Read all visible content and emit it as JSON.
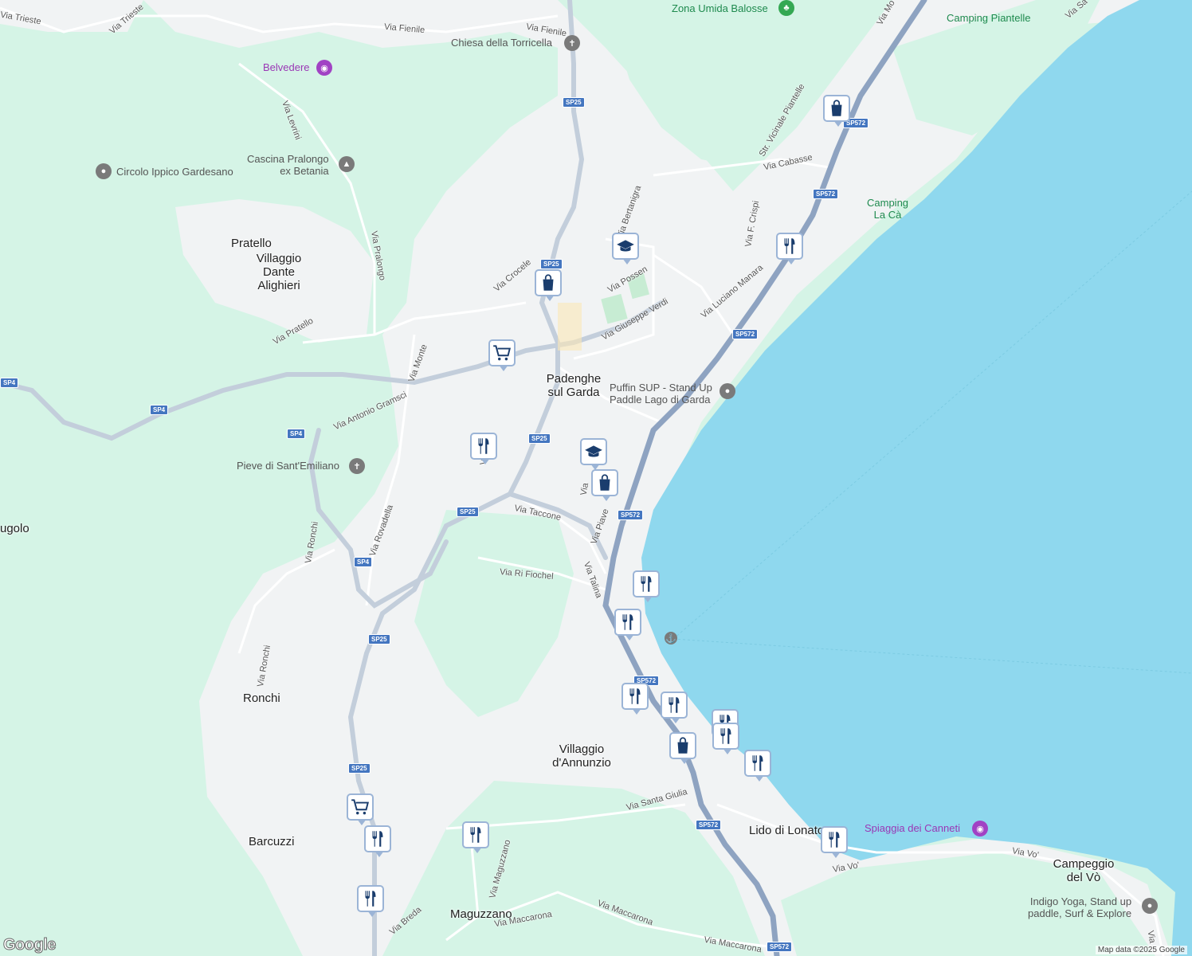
{
  "map": {
    "credit": "Map data ©2025 Google",
    "logo": "Google"
  },
  "colors": {
    "land_green": "#d5f4e6",
    "urban": "#f1f3f4",
    "lake": "#8fd8ee",
    "road": "#ffffff",
    "highway": "#8ea3c1",
    "marker_icon": "#1a3d6d"
  },
  "places": {
    "padenghe": "Padenghe\nsul Garda",
    "pratello": "Pratello",
    "villaggio_dante": "Villaggio\nDante\nAlighieri",
    "ronchi": "Ronchi",
    "barcuzzi": "Barcuzzi",
    "villaggio_annunzio": "Villaggio\nd'Annunzio",
    "maguzzano": "Maguzzano",
    "lido_lonato": "Lido di Lonato",
    "campeggio_vo": "Campeggio\ndel Vò",
    "ugolo": "ugolo"
  },
  "pois": {
    "zona_umida": "Zona Umida Balosse",
    "camping_piantelle": "Camping Piantelle",
    "chiesa": "Chiesa della Torricella",
    "belvedere": "Belvedere",
    "cascina": "Cascina Pralongo\nex Betania",
    "circolo": "Circolo Ippico Gardesano",
    "camping_la_ca": "Camping\nLa Cà",
    "puffin": "Puffin SUP - Stand Up\nPaddle Lago di Garda",
    "pieve": "Pieve di Sant'Emiliano",
    "spiaggia": "Spiaggia dei Canneti",
    "indigo": "Indigo Yoga, Stand up\npaddle, Surf & Explore"
  },
  "streets": {
    "via_trieste": "Via Trieste",
    "via_fienile": "Via Fienile",
    "via_levrini": "Via Levrini",
    "via_pralongo": "Via Pralongo",
    "via_pratello": "Via Pratello",
    "via_monte": "Via Monte",
    "via_gramsci": "Via Antonio Gramsci",
    "via_croce": "Via Crocele",
    "via_bertanigra": "Via Bertanigra",
    "via_possen": "Via Possen",
    "via_verdi": "Via Giuseppe Verdi",
    "via_cabasse": "Via Cabasse",
    "str_piantelle": "Str. Vicinale Piantelle",
    "via_crispi": "Via F. Crispi",
    "via_manara": "Via Luciano Manara",
    "via_taccone": "Via Taccone",
    "via_piave": "Via Piave",
    "via_talina": "Via Talina",
    "via_fiochel": "Via Ri Fiochel",
    "via_rovadella": "Via Rovadella",
    "via_ronchi": "Via Ronchi",
    "via_ronchi2": "Via Ronchi",
    "via_santa_giulia": "Via Santa Giulia",
    "via_maguzzano": "Via Maguzzano",
    "via_maccarona": "Via Maccarona",
    "via_maccarona2": "Via Maccarona",
    "via_maccarona3": "Via Maccarona",
    "via_breda": "Via Breda",
    "via_vo": "Via Vo'",
    "via_vo2": "Via Vo'",
    "via_mo": "Via Mo",
    "via_sa": "Via Sa",
    "via_p": "Via P",
    "via_via": "Via"
  },
  "shields": {
    "sp25_a": "SP25",
    "sp25_b": "SP25",
    "sp25_c": "SP25",
    "sp25_d": "SP25",
    "sp25_e": "SP25",
    "sp25_f": "SP25",
    "sp4_a": "SP4",
    "sp4_b": "SP4",
    "sp4_c": "SP4",
    "sp4_d": "SP4",
    "sp572_a": "SP572",
    "sp572_b": "SP572",
    "sp572_c": "SP572",
    "sp572_d": "SP572",
    "sp572_e": "SP572",
    "sp572_f": "SP572",
    "sp572_g": "SP572"
  },
  "markers": [
    {
      "type": "shopping-bag"
    },
    {
      "type": "restaurant"
    },
    {
      "type": "school"
    },
    {
      "type": "shopping-bag"
    },
    {
      "type": "shopping-cart"
    },
    {
      "type": "restaurant"
    },
    {
      "type": "school"
    },
    {
      "type": "shopping-bag"
    },
    {
      "type": "restaurant"
    },
    {
      "type": "restaurant"
    },
    {
      "type": "restaurant"
    },
    {
      "type": "restaurant"
    },
    {
      "type": "restaurant"
    },
    {
      "type": "restaurant"
    },
    {
      "type": "shopping-bag"
    },
    {
      "type": "restaurant"
    },
    {
      "type": "shopping-cart"
    },
    {
      "type": "restaurant"
    },
    {
      "type": "restaurant"
    },
    {
      "type": "restaurant"
    },
    {
      "type": "restaurant"
    }
  ]
}
